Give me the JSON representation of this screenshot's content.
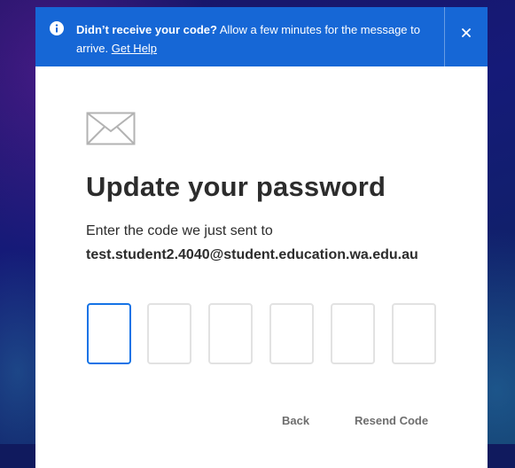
{
  "toast": {
    "icon": "info-icon",
    "bold_text": "Didn’t receive your code?",
    "text": " Allow a few minutes for the message to arrive. ",
    "link": "Get Help",
    "close_icon": "close-icon",
    "color": "#1667d6"
  },
  "form": {
    "icon": "envelope-icon",
    "title": "Update your password",
    "subtitle": "Enter the code we just sent to",
    "email": "test.student2.4040@student.education.wa.edu.au",
    "code_digits": [
      "",
      "",
      "",
      "",
      "",
      ""
    ],
    "active_digit": 1,
    "accent": "#1473e6"
  },
  "actions": {
    "back_label": "Back",
    "resend_label": "Resend Code"
  }
}
